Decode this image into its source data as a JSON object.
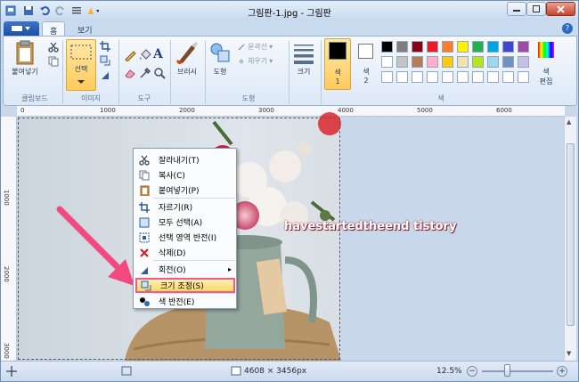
{
  "window": {
    "title": "그림판-1.jpg - 그림판"
  },
  "tabs": {
    "file_label": "",
    "home": "홈",
    "view": "보기"
  },
  "ribbon": {
    "clipboard": {
      "paste": "붙여넣기",
      "group": "클립보드"
    },
    "image": {
      "select": "선택",
      "group": "이미지"
    },
    "tools": {
      "text_icon": "A",
      "group": "도구"
    },
    "brushes": {
      "label": "브러시"
    },
    "shapes": {
      "shape": "도형",
      "outline": "윤곽선",
      "fill": "채우기",
      "group": "도형"
    },
    "size": {
      "label": "크기"
    },
    "colors": {
      "color1": "색",
      "color1_num": "1",
      "color2": "색",
      "color2_num": "2",
      "edit": "색\n편집",
      "edit_l1": "색",
      "edit_l2": "편집",
      "group": "색",
      "palette_row1": [
        "#000000",
        "#7f7f7f",
        "#880015",
        "#ed1c24",
        "#ff7f27",
        "#fff200",
        "#22b14c",
        "#00a2e8",
        "#3f48cc",
        "#a349a4"
      ],
      "palette_row2": [
        "#ffffff",
        "#c3c3c3",
        "#b97a57",
        "#ffaec9",
        "#ffc90e",
        "#efe4b0",
        "#b5e61d",
        "#99d9ea",
        "#7092be",
        "#c8bfe7"
      ],
      "palette_row3": [
        "#ffffff",
        "#ffffff",
        "#ffffff",
        "#ffffff",
        "#ffffff",
        "#ffffff",
        "#ffffff",
        "#ffffff",
        "#ffffff",
        "#ffffff"
      ]
    }
  },
  "rulers": {
    "h": [
      "0",
      "1000",
      "2000",
      "3000",
      "4000",
      "5000",
      "6000"
    ],
    "v": [
      "1000",
      "2000",
      "3000"
    ]
  },
  "watermark": "havestartedtheend tistory",
  "context_menu": {
    "items": [
      {
        "label": "잘라내기(T)",
        "icon": "scissors-icon"
      },
      {
        "label": "복사(C)",
        "icon": "copy-icon"
      },
      {
        "label": "붙여넣기(P)",
        "icon": "paste-icon"
      },
      {
        "label": "자르기(R)",
        "icon": "crop-icon"
      },
      {
        "label": "모두 선택(A)",
        "icon": "select-all-icon"
      },
      {
        "label": "선택 영역 반전(I)",
        "icon": "invert-selection-icon"
      },
      {
        "label": "삭제(D)",
        "icon": "delete-icon"
      },
      {
        "label": "회전(O)",
        "icon": "rotate-icon"
      },
      {
        "label": "크기 조정(S)",
        "icon": "resize-icon"
      },
      {
        "label": "색 반전(E)",
        "icon": "invert-color-icon"
      }
    ]
  },
  "status": {
    "dimensions": "4608 × 3456px",
    "zoom": "12.5%",
    "zoom_fraction": 0.35
  }
}
